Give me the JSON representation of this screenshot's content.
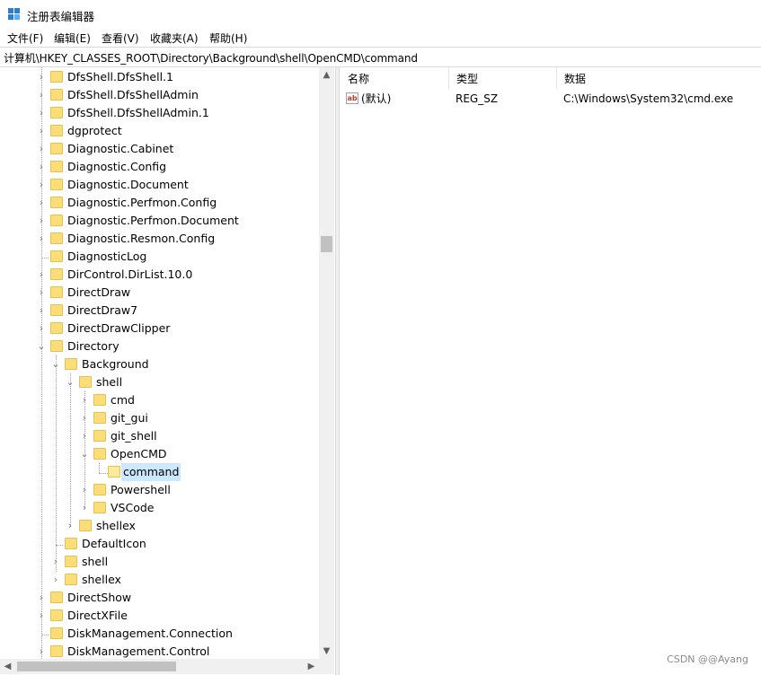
{
  "window": {
    "title": "注册表编辑器"
  },
  "menu": [
    {
      "label": "文件(F)"
    },
    {
      "label": "编辑(E)"
    },
    {
      "label": "查看(V)"
    },
    {
      "label": "收藏夹(A)"
    },
    {
      "label": "帮助(H)"
    }
  ],
  "address": "计算机\\HKEY_CLASSES_ROOT\\Directory\\Background\\shell\\OpenCMD\\command",
  "tree": [
    {
      "label": "DfsShell.DfsShell.1",
      "expander": "collapsed",
      "level": 0
    },
    {
      "label": "DfsShell.DfsShellAdmin",
      "expander": "collapsed",
      "level": 0
    },
    {
      "label": "DfsShell.DfsShellAdmin.1",
      "expander": "collapsed",
      "level": 0
    },
    {
      "label": "dgprotect",
      "expander": "collapsed",
      "level": 0
    },
    {
      "label": "Diagnostic.Cabinet",
      "expander": "collapsed",
      "level": 0
    },
    {
      "label": "Diagnostic.Config",
      "expander": "collapsed",
      "level": 0
    },
    {
      "label": "Diagnostic.Document",
      "expander": "collapsed",
      "level": 0
    },
    {
      "label": "Diagnostic.Perfmon.Config",
      "expander": "collapsed",
      "level": 0
    },
    {
      "label": "Diagnostic.Perfmon.Document",
      "expander": "collapsed",
      "level": 0
    },
    {
      "label": "Diagnostic.Resmon.Config",
      "expander": "collapsed",
      "level": 0
    },
    {
      "label": "DiagnosticLog",
      "expander": "none",
      "level": 0
    },
    {
      "label": "DirControl.DirList.10.0",
      "expander": "collapsed",
      "level": 0
    },
    {
      "label": "DirectDraw",
      "expander": "collapsed",
      "level": 0
    },
    {
      "label": "DirectDraw7",
      "expander": "collapsed",
      "level": 0
    },
    {
      "label": "DirectDrawClipper",
      "expander": "collapsed",
      "level": 0
    },
    {
      "label": "Directory",
      "expander": "expanded",
      "level": 0
    },
    {
      "label": "Background",
      "expander": "expanded",
      "level": 1
    },
    {
      "label": "shell",
      "expander": "expanded",
      "level": 2
    },
    {
      "label": "cmd",
      "expander": "collapsed",
      "level": 3
    },
    {
      "label": "git_gui",
      "expander": "collapsed",
      "level": 3
    },
    {
      "label": "git_shell",
      "expander": "collapsed",
      "level": 3
    },
    {
      "label": "OpenCMD",
      "expander": "expanded",
      "level": 3
    },
    {
      "label": "command",
      "expander": "none",
      "level": 4,
      "selected": true
    },
    {
      "label": "Powershell",
      "expander": "collapsed",
      "level": 3
    },
    {
      "label": "VSCode",
      "expander": "collapsed",
      "level": 3
    },
    {
      "label": "shellex",
      "expander": "collapsed",
      "level": 2
    },
    {
      "label": "DefaultIcon",
      "expander": "none",
      "level": 1
    },
    {
      "label": "shell",
      "expander": "collapsed",
      "level": 1
    },
    {
      "label": "shellex",
      "expander": "collapsed",
      "level": 1
    },
    {
      "label": "DirectShow",
      "expander": "collapsed",
      "level": 0
    },
    {
      "label": "DirectXFile",
      "expander": "collapsed",
      "level": 0
    },
    {
      "label": "DiskManagement.Connection",
      "expander": "none",
      "level": 0
    },
    {
      "label": "DiskManagement.Control",
      "expander": "collapsed",
      "level": 0
    }
  ],
  "list": {
    "headers": {
      "name": "名称",
      "type": "类型",
      "data": "数据"
    },
    "rows": [
      {
        "icon": "string-value-icon",
        "name": "(默认)",
        "type": "REG_SZ",
        "data": "C:\\Windows\\System32\\cmd.exe"
      }
    ]
  },
  "watermark": "CSDN @@Ayang",
  "colors": {
    "folder": "#fbde7a",
    "selection": "#cce8ff",
    "scrollbar": "#f0f0f0"
  }
}
